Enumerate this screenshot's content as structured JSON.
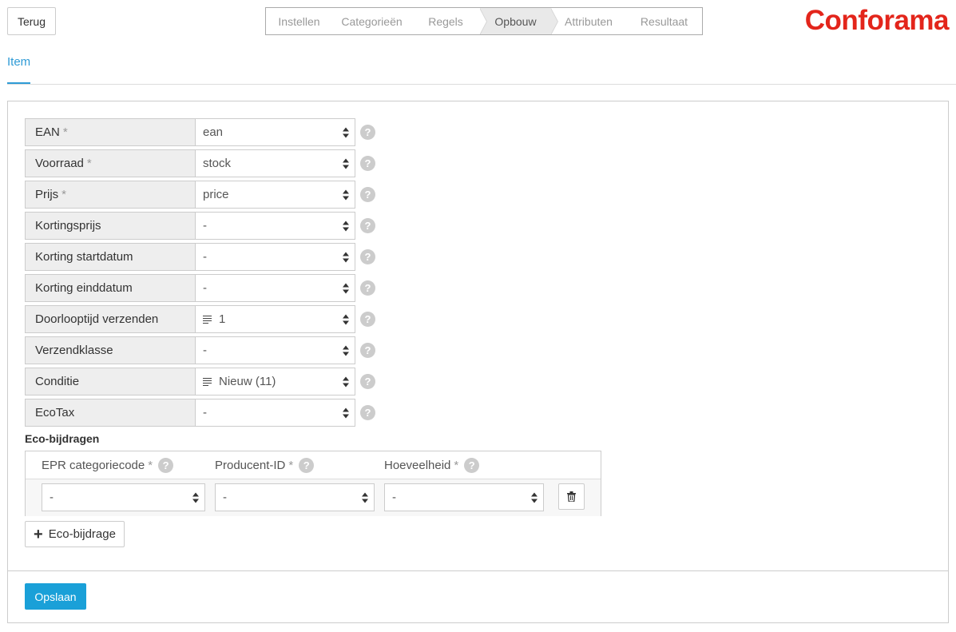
{
  "header": {
    "back_label": "Terug",
    "steps": [
      "Instellen",
      "Categorieën",
      "Regels",
      "Opbouw",
      "Attributen",
      "Resultaat"
    ],
    "active_step": "Opbouw",
    "brand": "Conforama",
    "brand_color": "#e3251b"
  },
  "tabs": {
    "active": "Item"
  },
  "fields": [
    {
      "label": "EAN",
      "required": "*",
      "value": "ean"
    },
    {
      "label": "Voorraad",
      "required": "*",
      "value": "stock"
    },
    {
      "label": "Prijs",
      "required": "*",
      "value": "price"
    },
    {
      "label": "Kortingsprijs",
      "required": "",
      "value": "-"
    },
    {
      "label": "Korting startdatum",
      "required": "",
      "value": "-"
    },
    {
      "label": "Korting einddatum",
      "required": "",
      "value": "-"
    },
    {
      "label": "Doorlooptijd verzenden",
      "required": "",
      "value": "1",
      "icon": "list-icon"
    },
    {
      "label": "Verzendklasse",
      "required": "",
      "value": "-"
    },
    {
      "label": "Conditie",
      "required": "",
      "value": "Nieuw (11)",
      "icon": "list-icon"
    },
    {
      "label": "EcoTax",
      "required": "",
      "value": "-"
    }
  ],
  "eco": {
    "title": "Eco-bijdragen",
    "columns": [
      {
        "label": "EPR categoriecode",
        "required": "*"
      },
      {
        "label": "Producent-ID",
        "required": "*"
      },
      {
        "label": "Hoeveelheid",
        "required": "*"
      }
    ],
    "row": [
      "-",
      "-",
      "-"
    ],
    "add_label": "Eco-bijdrage"
  },
  "footer": {
    "save_label": "Opslaan"
  },
  "accent_color": "#1aa0d8"
}
